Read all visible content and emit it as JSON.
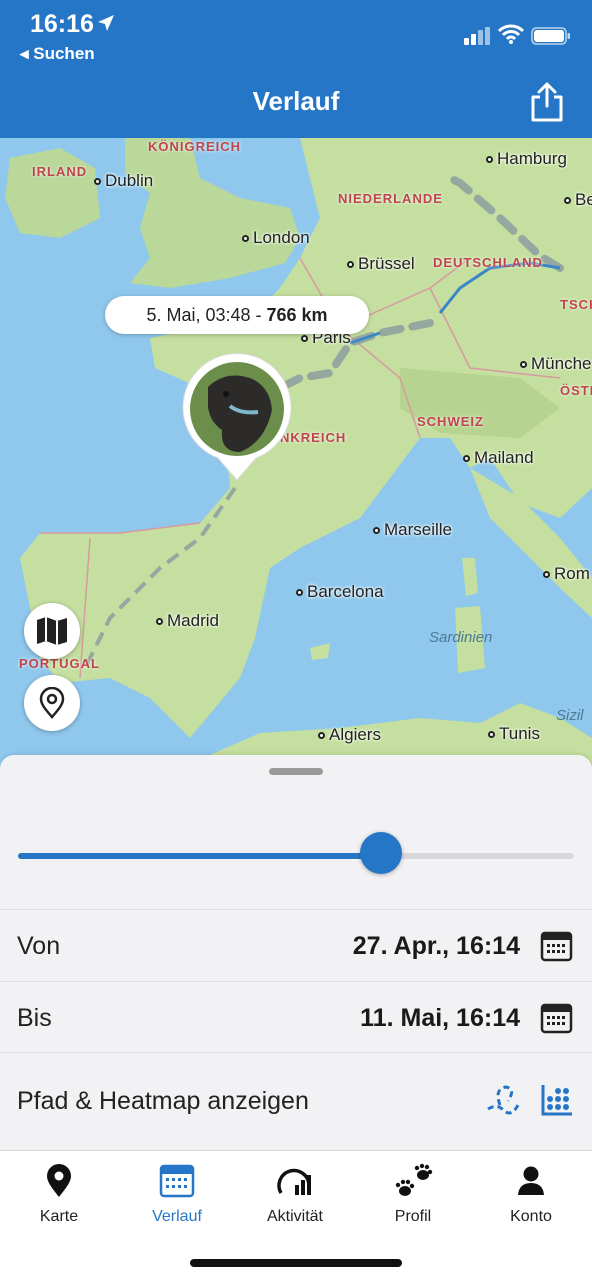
{
  "status": {
    "time": "16:16",
    "back_label": "◂ Suchen"
  },
  "header": {
    "title": "Verlauf",
    "share_icon": "share-icon"
  },
  "map": {
    "countries": [
      "KÖNIGREICH",
      "IRLAND",
      "NIEDERLANDE",
      "DEUTSCHLAND",
      "TSCH",
      "ÖSTE",
      "SCHWEIZ",
      "NKREICH",
      "PORTUGAL"
    ],
    "cities": [
      "Dublin",
      "London",
      "Hamburg",
      "Be",
      "Brüssel",
      "Paris",
      "Münche",
      "Mailand",
      "Marseille",
      "Rom",
      "Barcelona",
      "Madrid",
      "Algiers",
      "Tunis"
    ],
    "seas": [
      "Sardinien",
      "Sizil"
    ],
    "tooltip": {
      "date": "5. Mai, 03:48 - ",
      "distance": "766 km"
    }
  },
  "sheet": {
    "slider_value": 0.652,
    "from": {
      "label": "Von",
      "value": "27. Apr., 16:14"
    },
    "to": {
      "label": "Bis",
      "value": "11. Mai, 16:14"
    },
    "path": {
      "label": "Pfad & Heatmap anzeigen"
    }
  },
  "tabs": [
    {
      "label": "Karte",
      "icon": "map-pin-icon"
    },
    {
      "label": "Verlauf",
      "icon": "calendar-icon"
    },
    {
      "label": "Aktivität",
      "icon": "activity-gauge-icon"
    },
    {
      "label": "Profil",
      "icon": "paw-icon"
    },
    {
      "label": "Konto",
      "icon": "person-icon"
    }
  ],
  "colors": {
    "accent": "#2676c7"
  }
}
